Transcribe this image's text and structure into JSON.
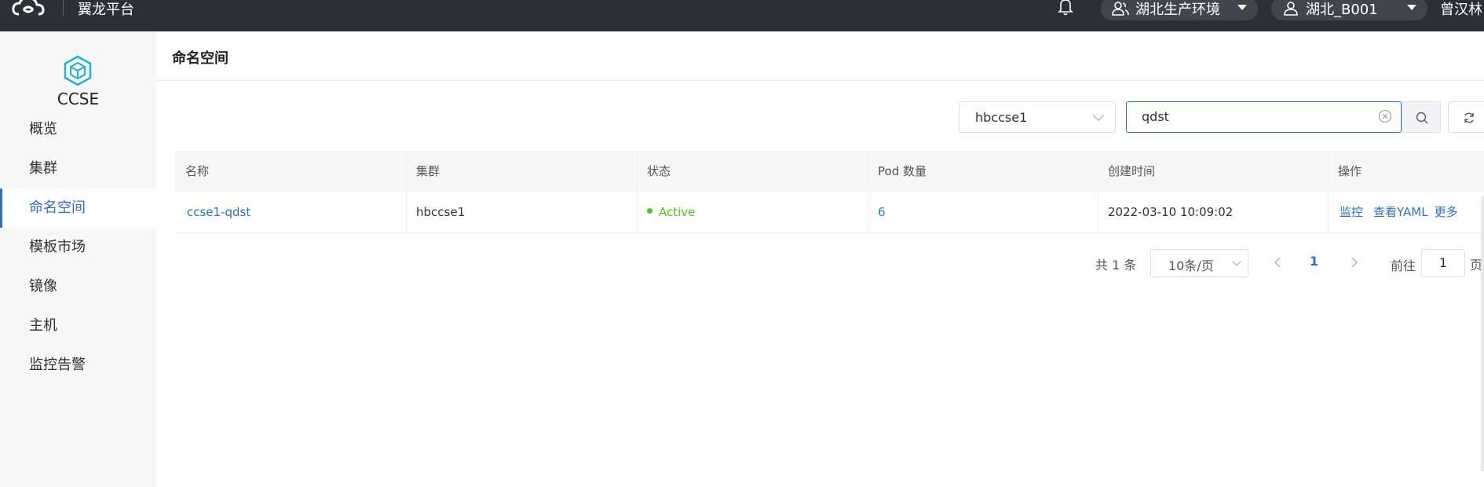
{
  "topbar": {
    "app_name": "翼龙平台",
    "environment": "湖北生产环境",
    "tenant": "湖北_B001",
    "user_name": "曾汉林"
  },
  "sidebar": {
    "product_name": "CCSE",
    "items": [
      {
        "label": "概览"
      },
      {
        "label": "集群"
      },
      {
        "label": "命名空间",
        "active": true
      },
      {
        "label": "模板市场"
      },
      {
        "label": "镜像"
      },
      {
        "label": "主机"
      },
      {
        "label": "监控告警"
      }
    ]
  },
  "page": {
    "title": "命名空间"
  },
  "filters": {
    "cluster_select": "hbccse1",
    "search_value": "qdst"
  },
  "table": {
    "columns": [
      "名称",
      "集群",
      "状态",
      "Pod 数量",
      "创建时间",
      "操作"
    ],
    "rows": [
      {
        "name": "ccse1-qdst",
        "cluster": "hbccse1",
        "status": "Active",
        "pod_count": "6",
        "created": "2022-03-10 10:09:02",
        "actions": [
          "监控",
          "查看YAML",
          "更多"
        ]
      }
    ]
  },
  "pagination": {
    "total": "共 1 条",
    "page_size": "10条/页",
    "current_page": "1",
    "goto_label": "前往",
    "goto_value": "1",
    "page_suffix": "页"
  },
  "colors": {
    "accent": "#2b6fd6",
    "topbar_bg": "#2b2f36",
    "status_active": "#52c41a"
  }
}
